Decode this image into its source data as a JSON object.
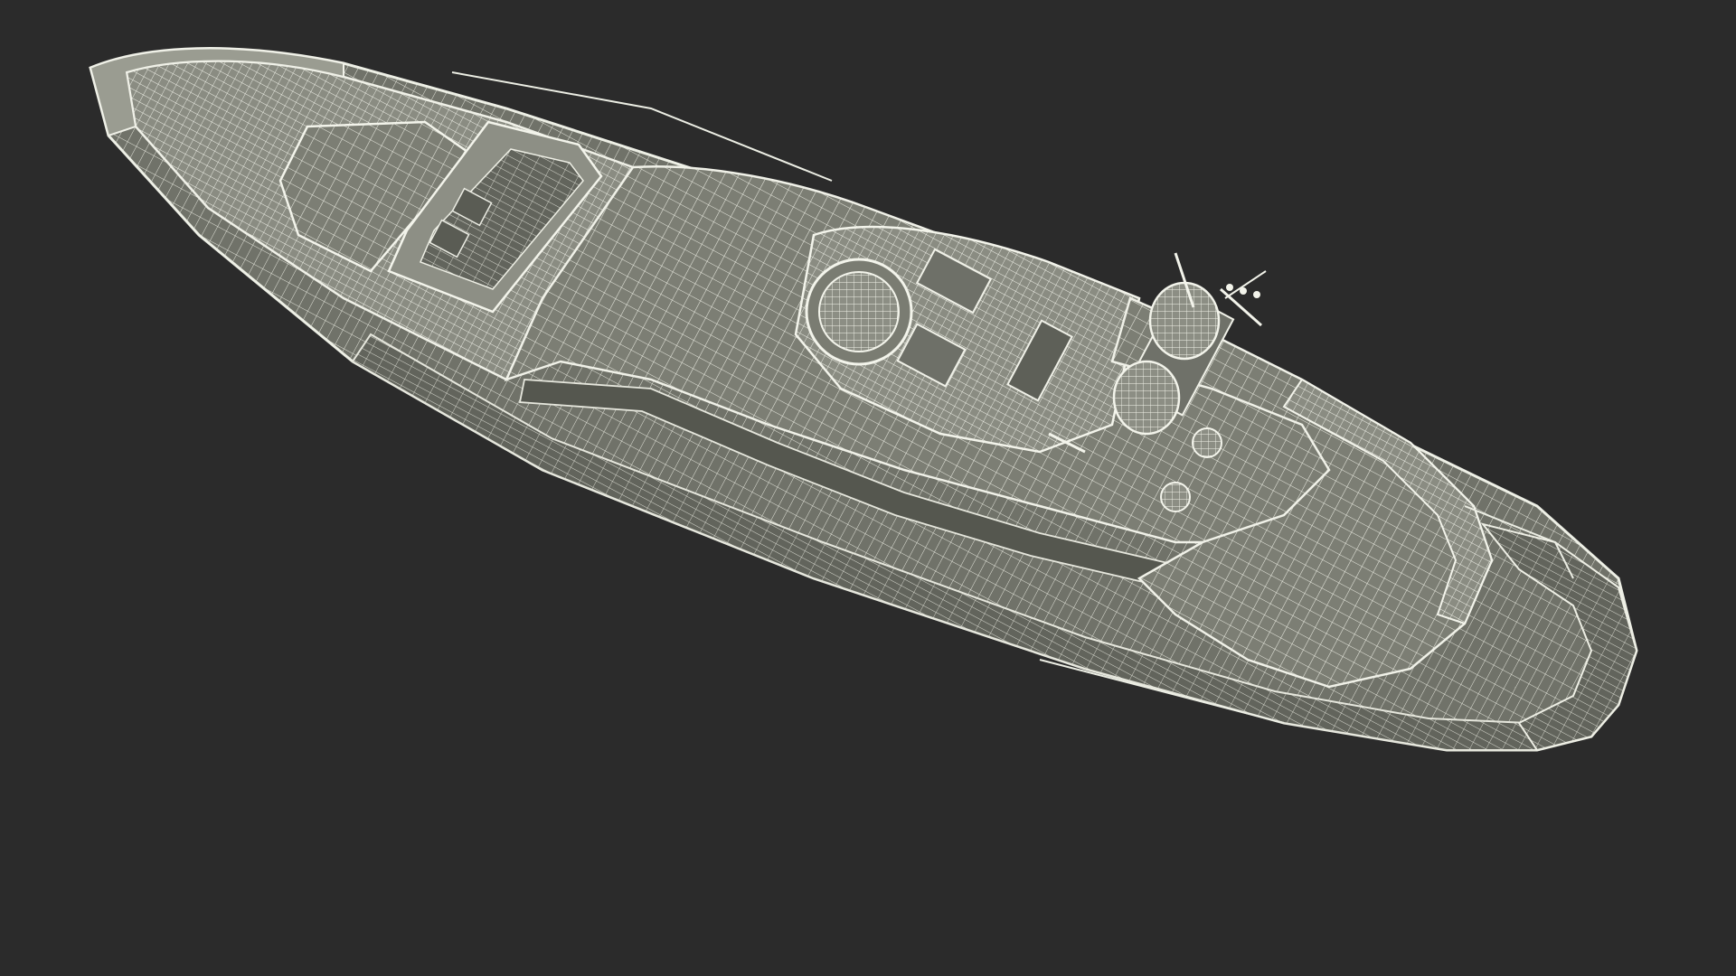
{
  "scene": {
    "subject": "yacht-wireframe-render",
    "background_color": "#2b2b2b",
    "mesh_fill_color": "#7d7f75",
    "mesh_fill_dark": "#5e6058",
    "mesh_fill_light": "#9a9c91",
    "wire_color": "#ecede4",
    "icons": [
      "radar-dome-icon",
      "antenna-mast-icon",
      "jacuzzi-icon"
    ]
  }
}
